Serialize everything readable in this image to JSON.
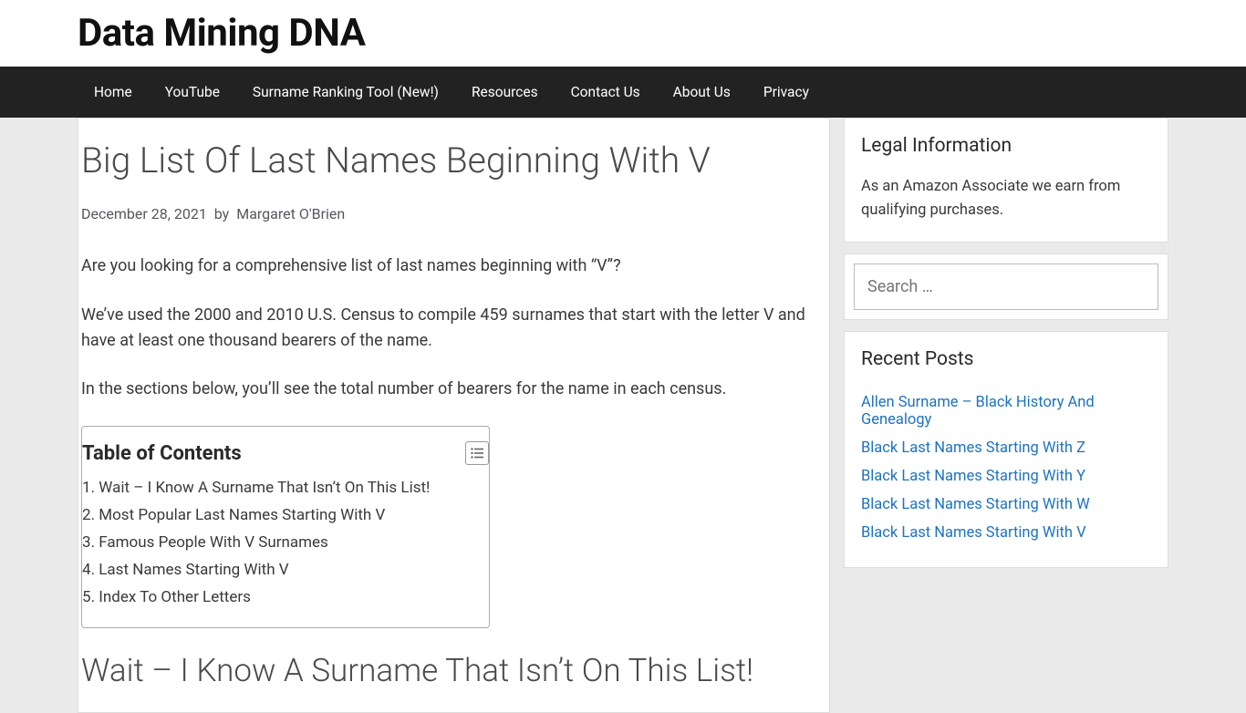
{
  "header": {
    "site_title": "Data Mining DNA"
  },
  "nav": {
    "items": [
      "Home",
      "YouTube",
      "Surname Ranking Tool (New!)",
      "Resources",
      "Contact Us",
      "About Us",
      "Privacy"
    ]
  },
  "article": {
    "title": "Big List Of Last Names Beginning With V",
    "date": "December 28, 2021",
    "by": "by",
    "author": "Margaret O'Brien",
    "p1": "Are you looking for a comprehensive list of last names beginning with “V”?",
    "p2": "We’ve used the 2000 and 2010 U.S. Census to compile 459 surnames that start with the letter V and have at least one thousand bearers of the name.",
    "p3": "In the sections below, you’ll see the total number of bearers for the name in each census.",
    "toc_title": "Table of Contents",
    "toc_items": [
      "Wait – I Know A Surname That Isn’t On This List!",
      "Most Popular Last Names Starting With V",
      "Famous People With V Surnames",
      "Last Names Starting With V",
      "Index To Other Letters"
    ],
    "h2": "Wait – I Know A Surname That Isn’t On This List!"
  },
  "sidebar": {
    "legal_title": "Legal Information",
    "legal_text": "As an Amazon Associate we earn from qualifying purchases.",
    "search_placeholder": "Search …",
    "recent_title": "Recent Posts",
    "recent_items": [
      "Allen Surname – Black History And Genealogy",
      "Black Last Names Starting With Z",
      "Black Last Names Starting With Y",
      "Black Last Names Starting With W",
      "Black Last Names Starting With V"
    ]
  }
}
